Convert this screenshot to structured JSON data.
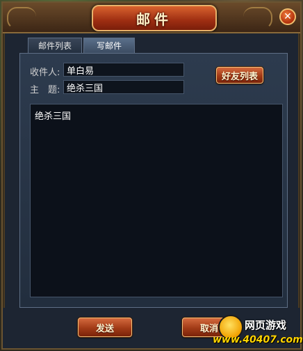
{
  "window": {
    "title": "邮件",
    "close_symbol": "✕"
  },
  "tabs": [
    {
      "label": "邮件列表",
      "active": false
    },
    {
      "label": "写邮件",
      "active": true
    }
  ],
  "compose": {
    "recipient_label": "收件人:",
    "recipient_value": "单白易",
    "subject_label": "主　题:",
    "subject_value": "绝杀三国",
    "body_value": "绝杀三国",
    "friends_button": "好友列表"
  },
  "footer": {
    "send_button": "发送",
    "cancel_button": "取消"
  },
  "watermark": {
    "line1": "网页游戏",
    "line2": "www.40407.com"
  },
  "colors": {
    "window_bg": "#1d2532",
    "panel_bg": "#2d3b4e",
    "button_red": "#a13a16",
    "button_border": "#f2c17a",
    "title_text": "#fff2c8"
  }
}
